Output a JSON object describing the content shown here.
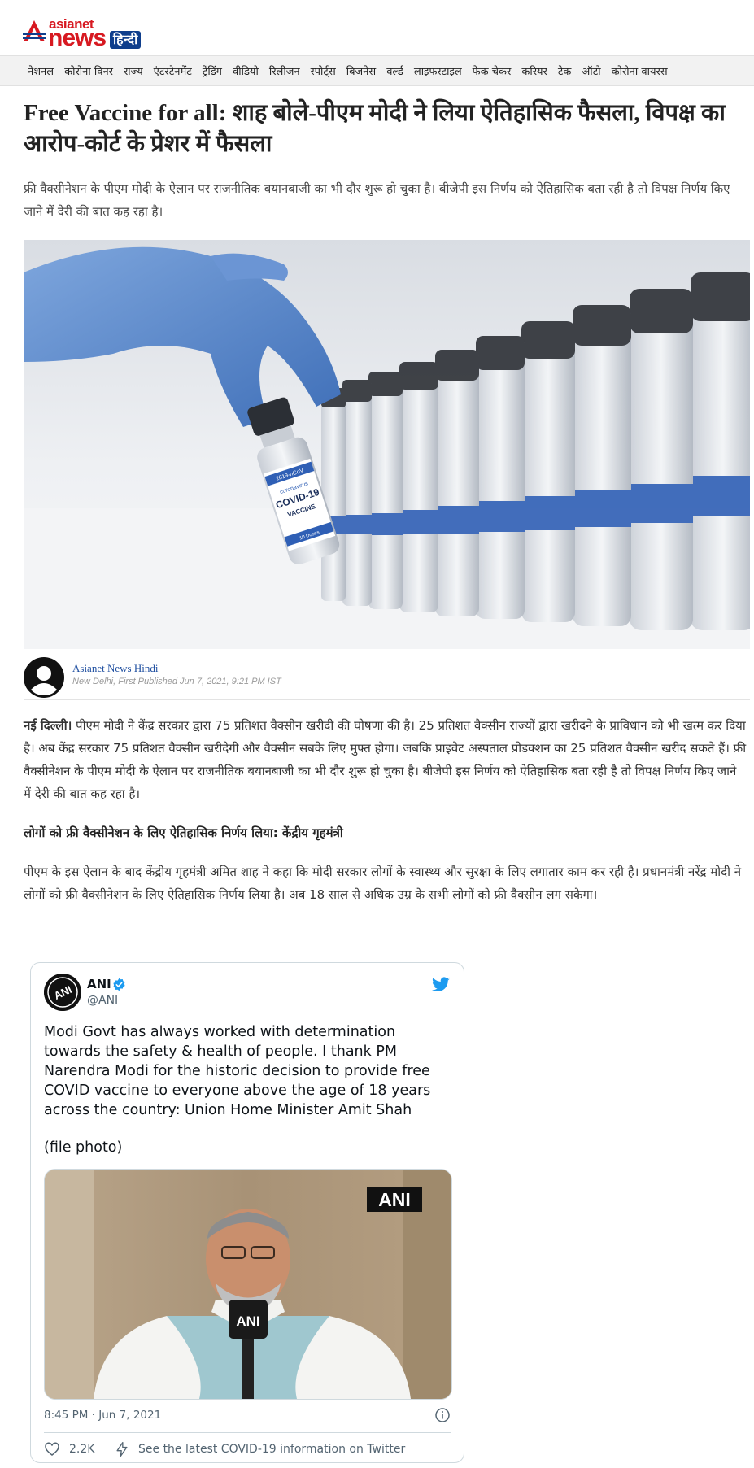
{
  "brand": {
    "asianet": "asianet",
    "news": "news",
    "hindi": "हिन्दी"
  },
  "nav": [
    "नेशनल",
    "कोरोना विनर",
    "राज्य",
    "एंटरटेनमेंट",
    "ट्रेंडिंग",
    "वीडियो",
    "रिलीजन",
    "स्पोर्ट्स",
    "बिजनेस",
    "वर्ल्ड",
    "लाइफस्टाइल",
    "फेक चेकर",
    "करियर",
    "टेक",
    "ऑटो",
    "कोरोना वायरस"
  ],
  "article": {
    "headline": "Free Vaccine for all: शाह बोले-पीएम मोदी ने लिया ऐतिहासिक फैसला, विपक्ष का आरोप-कोर्ट के प्रेशर में फैसला",
    "summary": "फ्री वैक्सीनेशन के पीएम मोदी के ऐलान पर राजनीतिक बयानबाजी का भी दौर शुरू हो चुका है। बीजेपी इस निर्णय को ऐतिहासिक बता रही है तो विपक्ष निर्णय किए जाने में देरी की बात कह रहा है।",
    "hero_vial_label": [
      "2019-nCoV",
      "coronavirus",
      "COVID-19",
      "VACCINE",
      "10 Doses"
    ],
    "author": "Asianet News Hindi",
    "meta": "New Delhi, First Published Jun 7, 2021, 9:21 PM IST",
    "dateline": "नई दिल्ली।",
    "para1": " पीएम मोदी ने केंद्र सरकार द्वारा 75 प्रतिशत वैक्सीन खरीदी की घोषणा की है। 25 प्रतिशत वैक्सीन राज्यों द्वारा खरीदने के प्राविधान को भी खत्म कर दिया है। अब केंद्र सरकार 75 प्रतिशत वैक्सीन खरीदेगी और वैक्सीन सबके लिए मुफ्त होगा। जबकि प्राइवेट अस्पताल प्रोडक्शन का 25 प्रतिशत वैक्सीन खरीद सकते हैं। फ्री वैक्सीनेशन के पीएम मोदी के ऐलान पर राजनीतिक बयानबाजी का भी दौर शुरू हो चुका है। बीजेपी इस निर्णय को ऐतिहासिक बता रही है तो विपक्ष निर्णय किए जाने में देरी की बात कह रहा है।",
    "subheading": "लोगों को फ्री वैक्सीनेशन के लिए ऐतिहासिक निर्णय लिया: केंद्रीय गृहमंत्री",
    "para2": "पीएम के इस ऐलान के बाद केंद्रीय गृहमंत्री अमित शाह ने कहा कि मोदी सरकार लोगों के स्वास्थ्य और सुरक्षा के लिए लगातार काम कर रही है। प्रधानमंत्री नरेंद्र मोदी ने लोगों को फ्री वैक्सीनेशन के लिए ऐतिहासिक निर्णय लिया है। अब 18 साल से अधिक उम्र के सभी लोगों को फ्री वैक्सीन लग सकेगा।"
  },
  "tweet": {
    "name": "ANI",
    "handle": "@ANI",
    "text": "Modi Govt has always worked with determination towards the safety & health of people. I thank PM Narendra Modi for the historic decision to provide free COVID vaccine to everyone above the age of 18 years across the country: Union Home Minister Amit Shah",
    "file_note": "(file photo)",
    "watermark": "ANI",
    "mic_label": "ANI",
    "time": "8:45 PM · Jun 7, 2021",
    "likes": "2.2K",
    "covid_link": "See the latest COVID-19 information on Twitter"
  },
  "colors": {
    "brand_red": "#d71921",
    "brand_blue": "#0f3e8c",
    "twitter_blue": "#1d9bf0",
    "author_link": "#1f4fa0"
  }
}
